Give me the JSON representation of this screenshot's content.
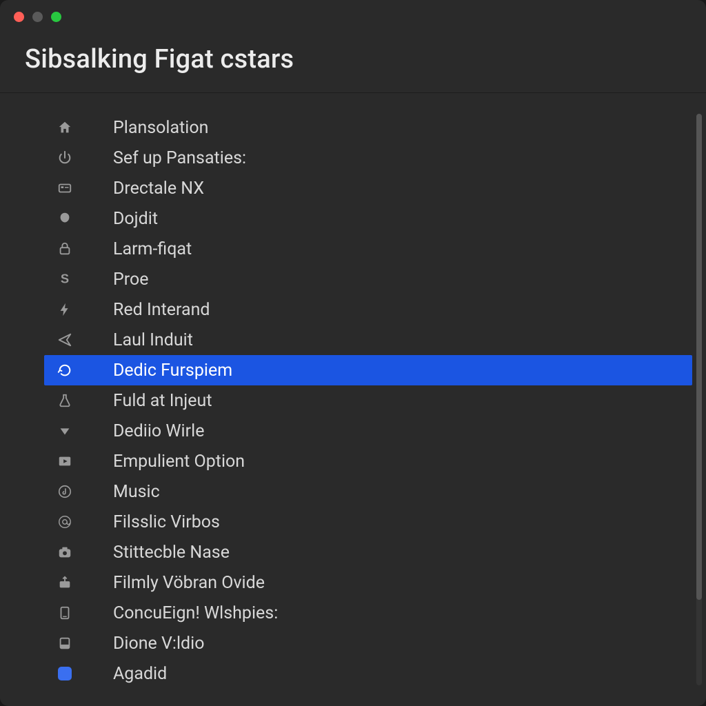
{
  "window": {
    "title": "Sibsalking Figat cstars"
  },
  "menu": {
    "items": [
      {
        "icon": "home-icon",
        "label": "Plansolation",
        "selected": false
      },
      {
        "icon": "power-icon",
        "label": "Sef up Pansaties:",
        "selected": false
      },
      {
        "icon": "id-card-icon",
        "label": "Drectale NX",
        "selected": false
      },
      {
        "icon": "blob-icon",
        "label": "Dojdit",
        "selected": false
      },
      {
        "icon": "lock-icon",
        "label": "Larm-fiqat",
        "selected": false
      },
      {
        "icon": "s-letter-icon",
        "label": "Proe",
        "selected": false
      },
      {
        "icon": "bolt-icon",
        "label": "Red Interand",
        "selected": false
      },
      {
        "icon": "send-icon",
        "label": "Laul Induit",
        "selected": false
      },
      {
        "icon": "refresh-icon",
        "label": "Dedic Furspiem",
        "selected": true
      },
      {
        "icon": "flask-icon",
        "label": "Fuld at Injeut",
        "selected": false
      },
      {
        "icon": "triangle-down-icon",
        "label": "Dediio Wirle",
        "selected": false
      },
      {
        "icon": "play-box-icon",
        "label": "Empulient Option",
        "selected": false
      },
      {
        "icon": "music-note-icon",
        "label": "Music",
        "selected": false
      },
      {
        "icon": "at-sign-icon",
        "label": "Filsslic Virbos",
        "selected": false
      },
      {
        "icon": "camera-icon",
        "label": "Stittecble Nase",
        "selected": false
      },
      {
        "icon": "upload-box-icon",
        "label": "Filmly Vöbran Ovide",
        "selected": false
      },
      {
        "icon": "tablet-icon",
        "label": "ConcuEign! Wlshpies:",
        "selected": false
      },
      {
        "icon": "panel-icon",
        "label": "Dione V:ldio",
        "selected": false
      },
      {
        "icon": "app-badge-icon",
        "label": "Agadid",
        "selected": false
      }
    ]
  },
  "colors": {
    "selection": "#1b55e2",
    "background": "#2a2a2a"
  }
}
